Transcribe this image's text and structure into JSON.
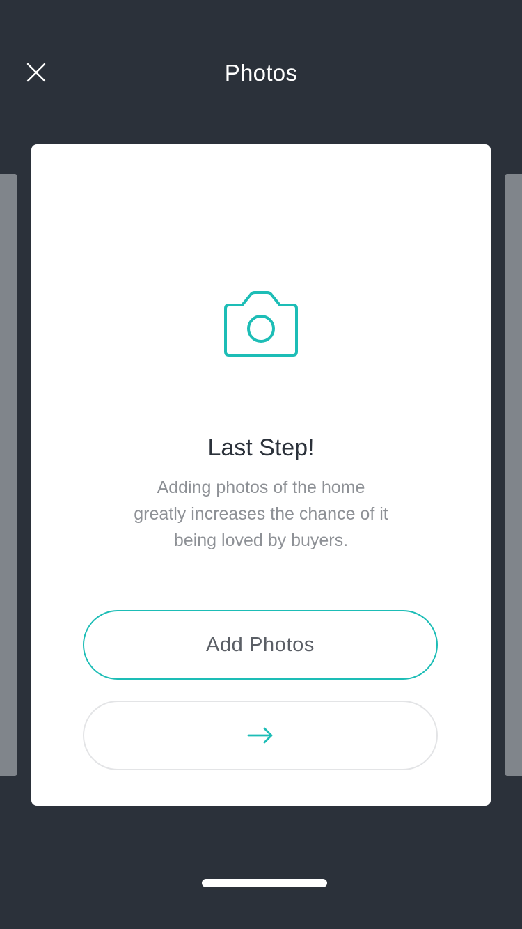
{
  "header": {
    "title": "Photos",
    "close_icon": "close-icon"
  },
  "card": {
    "icon": "camera-icon",
    "heading": "Last Step!",
    "body_lines": [
      "Adding photos of the home",
      "greatly increases the chance of it",
      "being loved by buyers."
    ],
    "add_photos_label": "Add Photos",
    "next_icon": "arrow-right-icon"
  },
  "colors": {
    "background": "#2b313a",
    "accent": "#1dbdb6",
    "card": "#ffffff",
    "side_cards": "#80858b",
    "body_text": "#8e9196",
    "heading_text": "#2b313a",
    "secondary_border": "#e3e4e6"
  }
}
